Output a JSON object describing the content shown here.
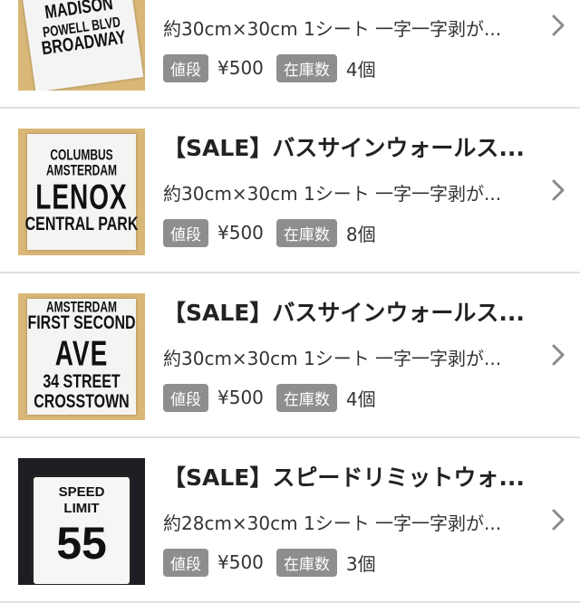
{
  "items": [
    {
      "title": "",
      "desc": "約30cm×30cm 1シート 一字一字剥が...",
      "price_label": "値段",
      "price": "¥500",
      "stock_label": "在庫数",
      "stock": "4個",
      "image_text": [
        "MADISON",
        "POWELL BLVD",
        "BROADWAY"
      ]
    },
    {
      "title": "【SALE】バスサインウォールス...",
      "desc": "約30cm×30cm 1シート 一字一字剥が...",
      "price_label": "値段",
      "price": "¥500",
      "stock_label": "在庫数",
      "stock": "8個",
      "image_text": [
        "COLUMBUS",
        "AMSTERDAM",
        "LENOX",
        "CENTRAL PARK"
      ]
    },
    {
      "title": "【SALE】バスサインウォールス...",
      "desc": "約30cm×30cm 1シート 一字一字剥が...",
      "price_label": "値段",
      "price": "¥500",
      "stock_label": "在庫数",
      "stock": "4個",
      "image_text": [
        "AMSTERDAM",
        "FIRST SECOND",
        "AVE",
        "34 STREET",
        "CROSSTOWN"
      ]
    },
    {
      "title": "【SALE】スピードリミットウォ...",
      "desc": "約28cm×30cm 1シート 一字一字剥が...",
      "price_label": "値段",
      "price": "¥500",
      "stock_label": "在庫数",
      "stock": "3個",
      "image_text": [
        "SPEED",
        "LIMIT",
        "55"
      ]
    }
  ],
  "colors": {
    "badge": "#8e8e8e",
    "divider": "#e0e0e0",
    "chevron": "#8a8a8a",
    "thumb_wood": "#d9b777",
    "thumb_dark": "#1c1e24"
  },
  "icons": {
    "row_disclosure": "chevron-right-icon"
  }
}
